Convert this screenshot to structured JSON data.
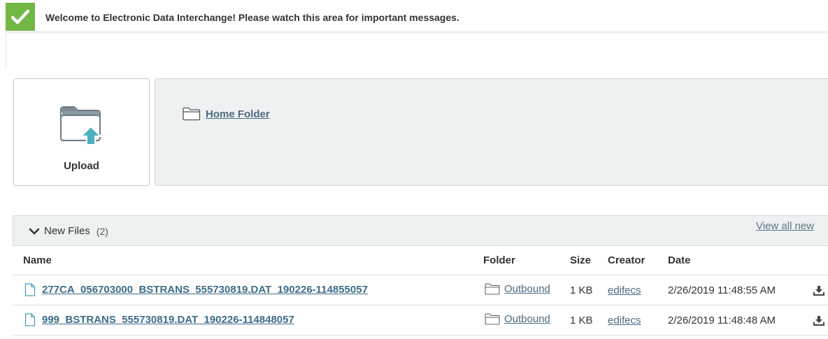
{
  "banner": {
    "message": "Welcome to Electronic Data Interchange! Please watch this area for important messages.",
    "icon": "check-icon",
    "color": "#73b744"
  },
  "upload": {
    "label": "Upload",
    "icon": "folder-upload-icon"
  },
  "home_folder": {
    "label": "Home Folder",
    "icon": "folder-icon"
  },
  "new_files": {
    "title": "New Files",
    "count": "(2)",
    "view_all": "View all new",
    "columns": {
      "name": "Name",
      "folder": "Folder",
      "size": "Size",
      "creator": "Creator",
      "date": "Date"
    },
    "rows": [
      {
        "name": "277CA_056703000_BSTRANS_555730819.DAT_190226-114855057",
        "folder": "Outbound",
        "size": "1 KB",
        "creator": "edifecs",
        "date": "2/26/2019 11:48:55 AM"
      },
      {
        "name": "999_BSTRANS_555730819.DAT_190226-114848057",
        "folder": "Outbound",
        "size": "1 KB",
        "creator": "edifecs",
        "date": "2/26/2019 11:48:48 AM"
      }
    ]
  }
}
